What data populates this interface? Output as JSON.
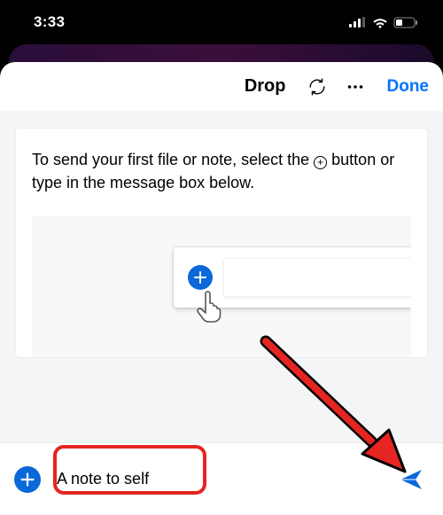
{
  "status": {
    "time": "3:33"
  },
  "header": {
    "title": "Drop",
    "done_label": "Done"
  },
  "card": {
    "instruction_before": "To send your first file or note, select the ",
    "instruction_after": " button or type in the message box below."
  },
  "compose": {
    "placeholder": "A note to self"
  },
  "colors": {
    "accent_blue": "#0a68d8",
    "link_blue": "#0073ff",
    "annotation_red": "#e52521"
  },
  "annotations": {
    "highlight_box": true,
    "pointer_arrow": true
  }
}
